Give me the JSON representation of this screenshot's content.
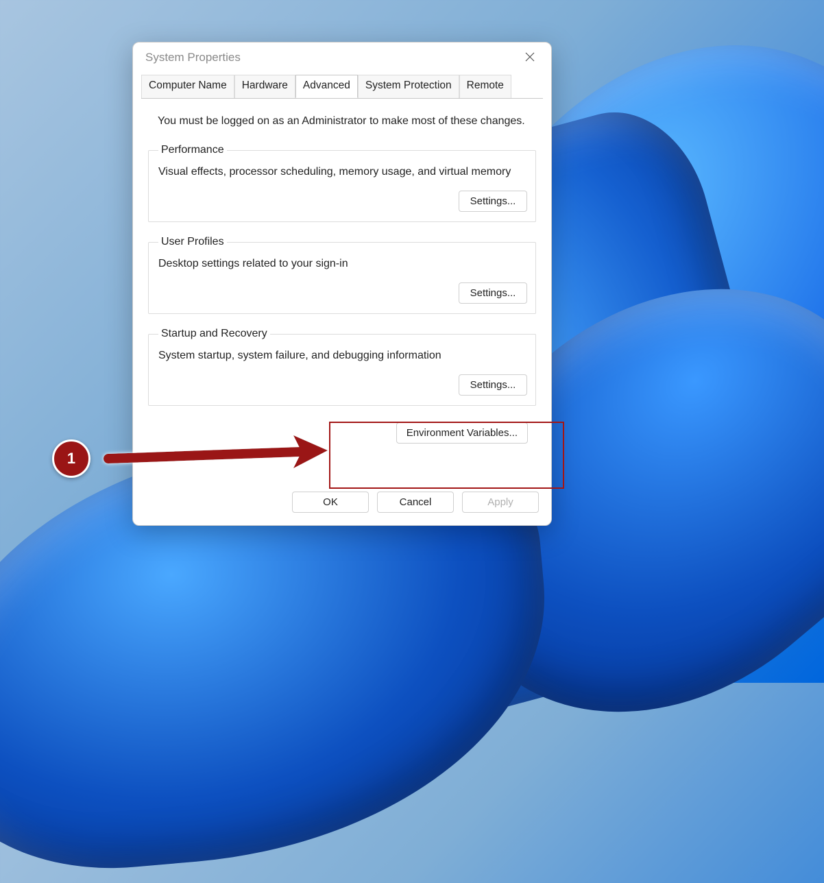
{
  "dialog": {
    "title": "System Properties",
    "close_tooltip": "Close",
    "tabs": [
      {
        "label": "Computer Name",
        "active": false
      },
      {
        "label": "Hardware",
        "active": false
      },
      {
        "label": "Advanced",
        "active": true
      },
      {
        "label": "System Protection",
        "active": false
      },
      {
        "label": "Remote",
        "active": false
      }
    ],
    "admin_note": "You must be logged on as an Administrator to make most of these changes.",
    "groups": {
      "performance": {
        "legend": "Performance",
        "desc": "Visual effects, processor scheduling, memory usage, and virtual memory",
        "button": "Settings..."
      },
      "user_profiles": {
        "legend": "User Profiles",
        "desc": "Desktop settings related to your sign-in",
        "button": "Settings..."
      },
      "startup": {
        "legend": "Startup and Recovery",
        "desc": "System startup, system failure, and debugging information",
        "button": "Settings..."
      }
    },
    "env_var_button": "Environment Variables...",
    "buttons": {
      "ok": "OK",
      "cancel": "Cancel",
      "apply": "Apply"
    }
  },
  "annotation": {
    "step_number": "1",
    "highlight_color": "#a21616"
  }
}
